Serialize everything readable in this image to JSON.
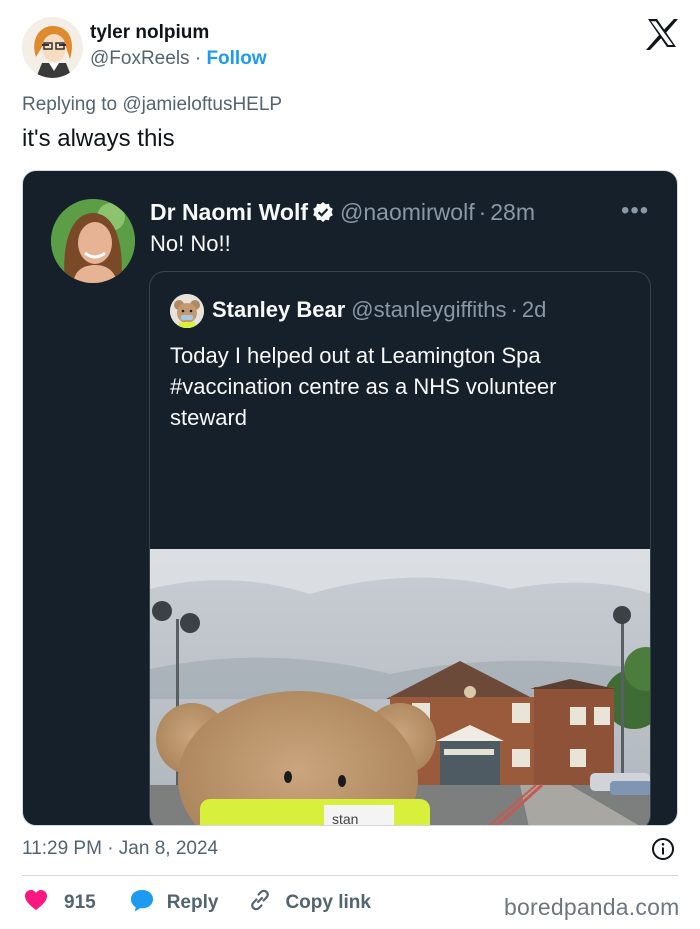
{
  "author": {
    "display_name": "tyler nolpium",
    "handle": "@FoxReels",
    "separator": "·",
    "follow_label": "Follow"
  },
  "reply": {
    "prefix": "Replying to",
    "mention": "@jamieloftusHELP"
  },
  "tweet": {
    "text": "it's always this"
  },
  "embedded": {
    "author": {
      "name": "Dr Naomi Wolf",
      "handle": "@naomirwolf",
      "time": "28m",
      "text": "No! No!!"
    },
    "quoted": {
      "name": "Stanley Bear",
      "handle": "@stanleygiffiths",
      "time": "2d",
      "text": "Today I helped out at Leamington Spa #vaccination centre as a NHS volunteer steward",
      "photo_sign": "stan"
    }
  },
  "meta": {
    "timestamp": "11:29 PM · Jan 8, 2024"
  },
  "actions": {
    "likes": "915",
    "reply_label": "Reply",
    "copy_label": "Copy link"
  },
  "watermark": "boredpanda.com",
  "colors": {
    "accent": "#1d9bf0",
    "like": "#f91880",
    "dark_bg": "#15202b"
  }
}
